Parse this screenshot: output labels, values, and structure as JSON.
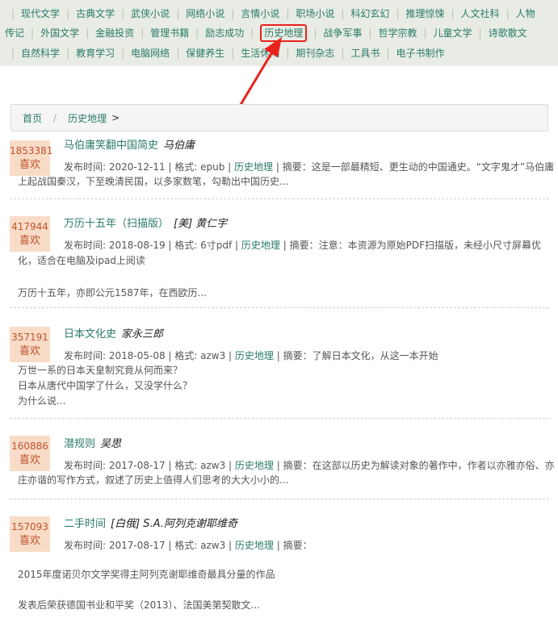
{
  "nav": {
    "rows": [
      [
        "现代文学",
        "古典文学",
        "武侠小说",
        "网络小说",
        "言情小说",
        "职场小说",
        "科幻玄幻",
        "推理惊悚",
        "人文社科",
        "人物"
      ],
      [
        "传记",
        "外国文学",
        "金融投资",
        "管理书籍",
        "励志成功",
        "历史地理",
        "战争军事",
        "哲学宗教",
        "儿童文学",
        "诗歌散文"
      ],
      [
        "自然科学",
        "教育学习",
        "电脑网络",
        "保健养生",
        "生活休闲",
        "期刊杂志",
        "工具书",
        "电子书制作"
      ]
    ],
    "active": "历史地理"
  },
  "breadcrumb": {
    "home": "首页",
    "sep": "/",
    "current": "历史地理",
    "gt": ">"
  },
  "books": [
    {
      "likes": "1853381",
      "like_label": "喜欢",
      "title": "马伯庸笑翻中国简史",
      "author": "马伯庸",
      "meta_prefix": "发布时间: 2020-12-11 | 格式: epub | ",
      "category": "历史地理",
      "meta_suffix": " | 摘要：这是一部最精短、更生动的中国通史。“文字鬼才”马伯庸",
      "summary": [
        "上起战国秦汉，下至晚清民国，以多家数笔，勾勒出中国历史..."
      ]
    },
    {
      "likes": "417944",
      "like_label": "喜欢",
      "title": "万历十五年（扫描版）",
      "author": "[美] 黄仁宇",
      "meta_prefix": "发布时间: 2018-08-19 | 格式: 6寸pdf | ",
      "category": "历史地理",
      "meta_suffix": " | 摘要：注意：本资源为原始PDF扫描版，未经小尺寸屏幕优",
      "summary": [
        "化，适合在电脑及ipad上阅读",
        "",
        "万历十五年，亦即公元1587年，在西欧历..."
      ]
    },
    {
      "likes": "357191",
      "like_label": "喜欢",
      "title": "日本文化史",
      "author": "家永三郎",
      "meta_prefix": "发布时间: 2018-05-08 | 格式: azw3 | ",
      "category": "历史地理",
      "meta_suffix": " | 摘要：了解日本文化，从这一本开始",
      "summary": [
        "万世一系的日本天皇制究竟从何而来？",
        "日本从唐代中国学了什么，又没学什么？",
        "为什么说..."
      ]
    },
    {
      "likes": "160886",
      "like_label": "喜欢",
      "title": "潜规则",
      "author": "吴思",
      "meta_prefix": "发布时间: 2017-08-17 | 格式: azw3 | ",
      "category": "历史地理",
      "meta_suffix": " | 摘要：在这部以历史为解读对象的著作中，作者以亦雅亦俗、亦",
      "summary": [
        "庄亦谐的写作方式，叙述了历史上值得人们思考的大大小小的..."
      ]
    },
    {
      "likes": "157093",
      "like_label": "喜欢",
      "title": "二手时间",
      "author": "[白俄] S.A.阿列克谢耶维奇",
      "meta_prefix": "发布时间: 2017-08-17 | 格式: azw3 | ",
      "category": "历史地理",
      "meta_suffix": " | 摘要：",
      "summary": [
        "",
        "2015年度诺贝尔文学奖得主阿列克谢耶维奇最具分量的作品",
        "",
        "发表后荣获德国书业和平奖（2013）、法国美第契散文..."
      ]
    }
  ]
}
